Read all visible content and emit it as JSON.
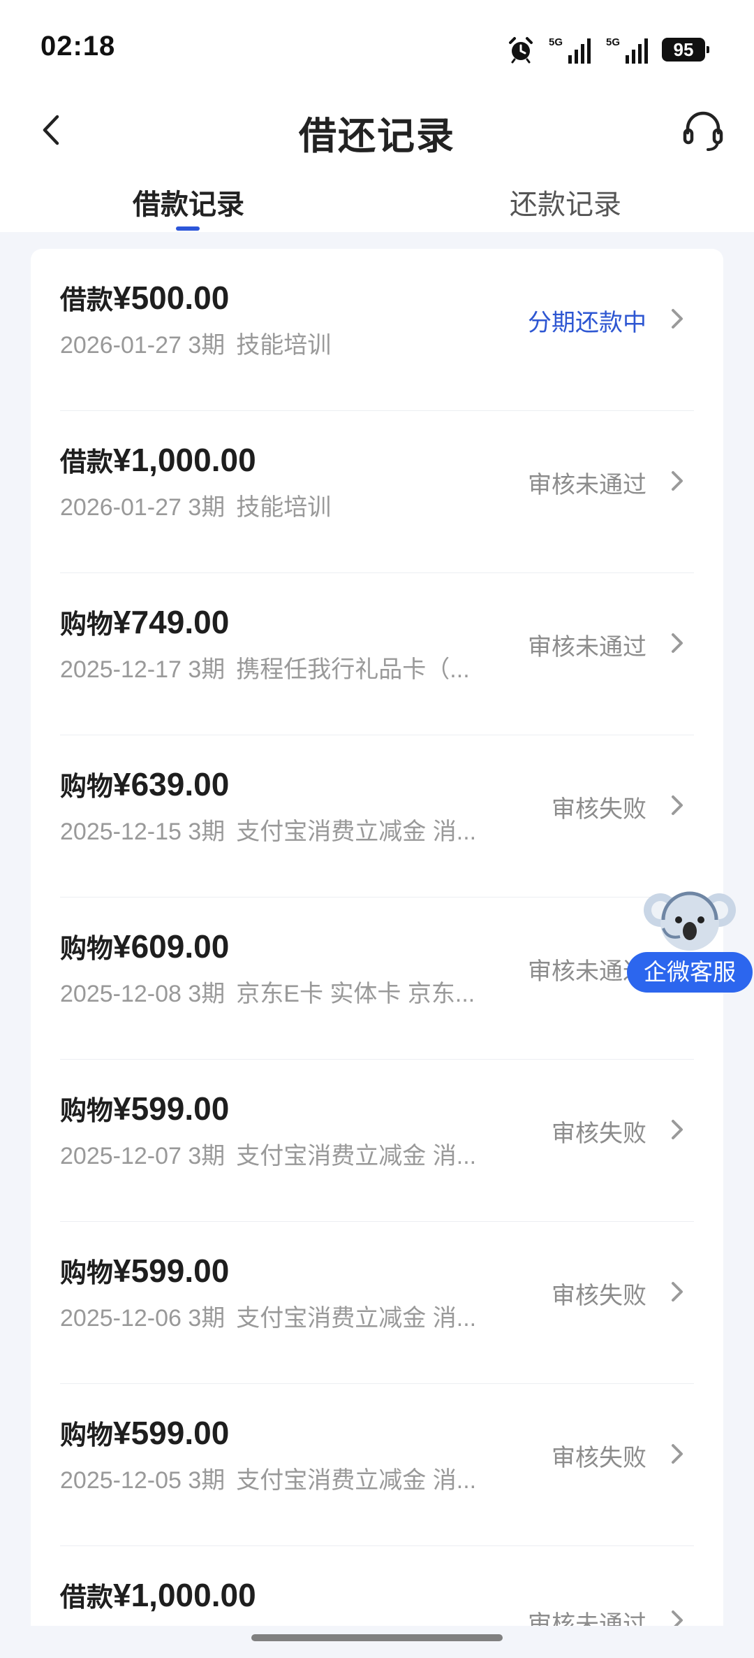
{
  "status_bar": {
    "time": "02:18",
    "battery": "95",
    "signal_1_label": "5G",
    "signal_2_label": "5G"
  },
  "header": {
    "title": "借还记录",
    "back_icon": "chevron-left-icon",
    "support_icon": "headset-icon"
  },
  "tabs": [
    {
      "label": "借款记录",
      "active": true
    },
    {
      "label": "还款记录",
      "active": false
    }
  ],
  "records": [
    {
      "type": "借款",
      "amount": "¥500.00",
      "date": "2026-01-27",
      "term": "3期",
      "desc": "技能培训",
      "status": "分期还款中",
      "status_color": "#2d56d2"
    },
    {
      "type": "借款",
      "amount": "¥1,000.00",
      "date": "2026-01-27",
      "term": "3期",
      "desc": "技能培训",
      "status": "审核未通过",
      "status_color": "#8c8c8c"
    },
    {
      "type": "购物",
      "amount": "¥749.00",
      "date": "2025-12-17",
      "term": "3期",
      "desc": "携程任我行礼品卡（...",
      "status": "审核未通过",
      "status_color": "#8c8c8c"
    },
    {
      "type": "购物",
      "amount": "¥639.00",
      "date": "2025-12-15",
      "term": "3期",
      "desc": "支付宝消费立减金 消...",
      "status": "审核失败",
      "status_color": "#8c8c8c"
    },
    {
      "type": "购物",
      "amount": "¥609.00",
      "date": "2025-12-08",
      "term": "3期",
      "desc": "京东E卡 实体卡 京东...",
      "status": "审核未通过",
      "status_color": "#8c8c8c"
    },
    {
      "type": "购物",
      "amount": "¥599.00",
      "date": "2025-12-07",
      "term": "3期",
      "desc": "支付宝消费立减金 消...",
      "status": "审核失败",
      "status_color": "#8c8c8c"
    },
    {
      "type": "购物",
      "amount": "¥599.00",
      "date": "2025-12-06",
      "term": "3期",
      "desc": "支付宝消费立减金 消...",
      "status": "审核失败",
      "status_color": "#8c8c8c"
    },
    {
      "type": "购物",
      "amount": "¥599.00",
      "date": "2025-12-05",
      "term": "3期",
      "desc": "支付宝消费立减金 消...",
      "status": "审核失败",
      "status_color": "#8c8c8c"
    },
    {
      "type": "借款",
      "amount": "¥1,000.00",
      "date": "",
      "term": "",
      "desc": "",
      "status": "审核未通过",
      "status_color": "#8c8c8c"
    }
  ],
  "floating_service": {
    "label": "企微客服",
    "icon": "koala-mascot-icon"
  },
  "colors": {
    "accent": "#2c56d9",
    "status_blue": "#2d56d2",
    "status_gray": "#8c8c8c",
    "service_pill": "#2c66ee"
  }
}
